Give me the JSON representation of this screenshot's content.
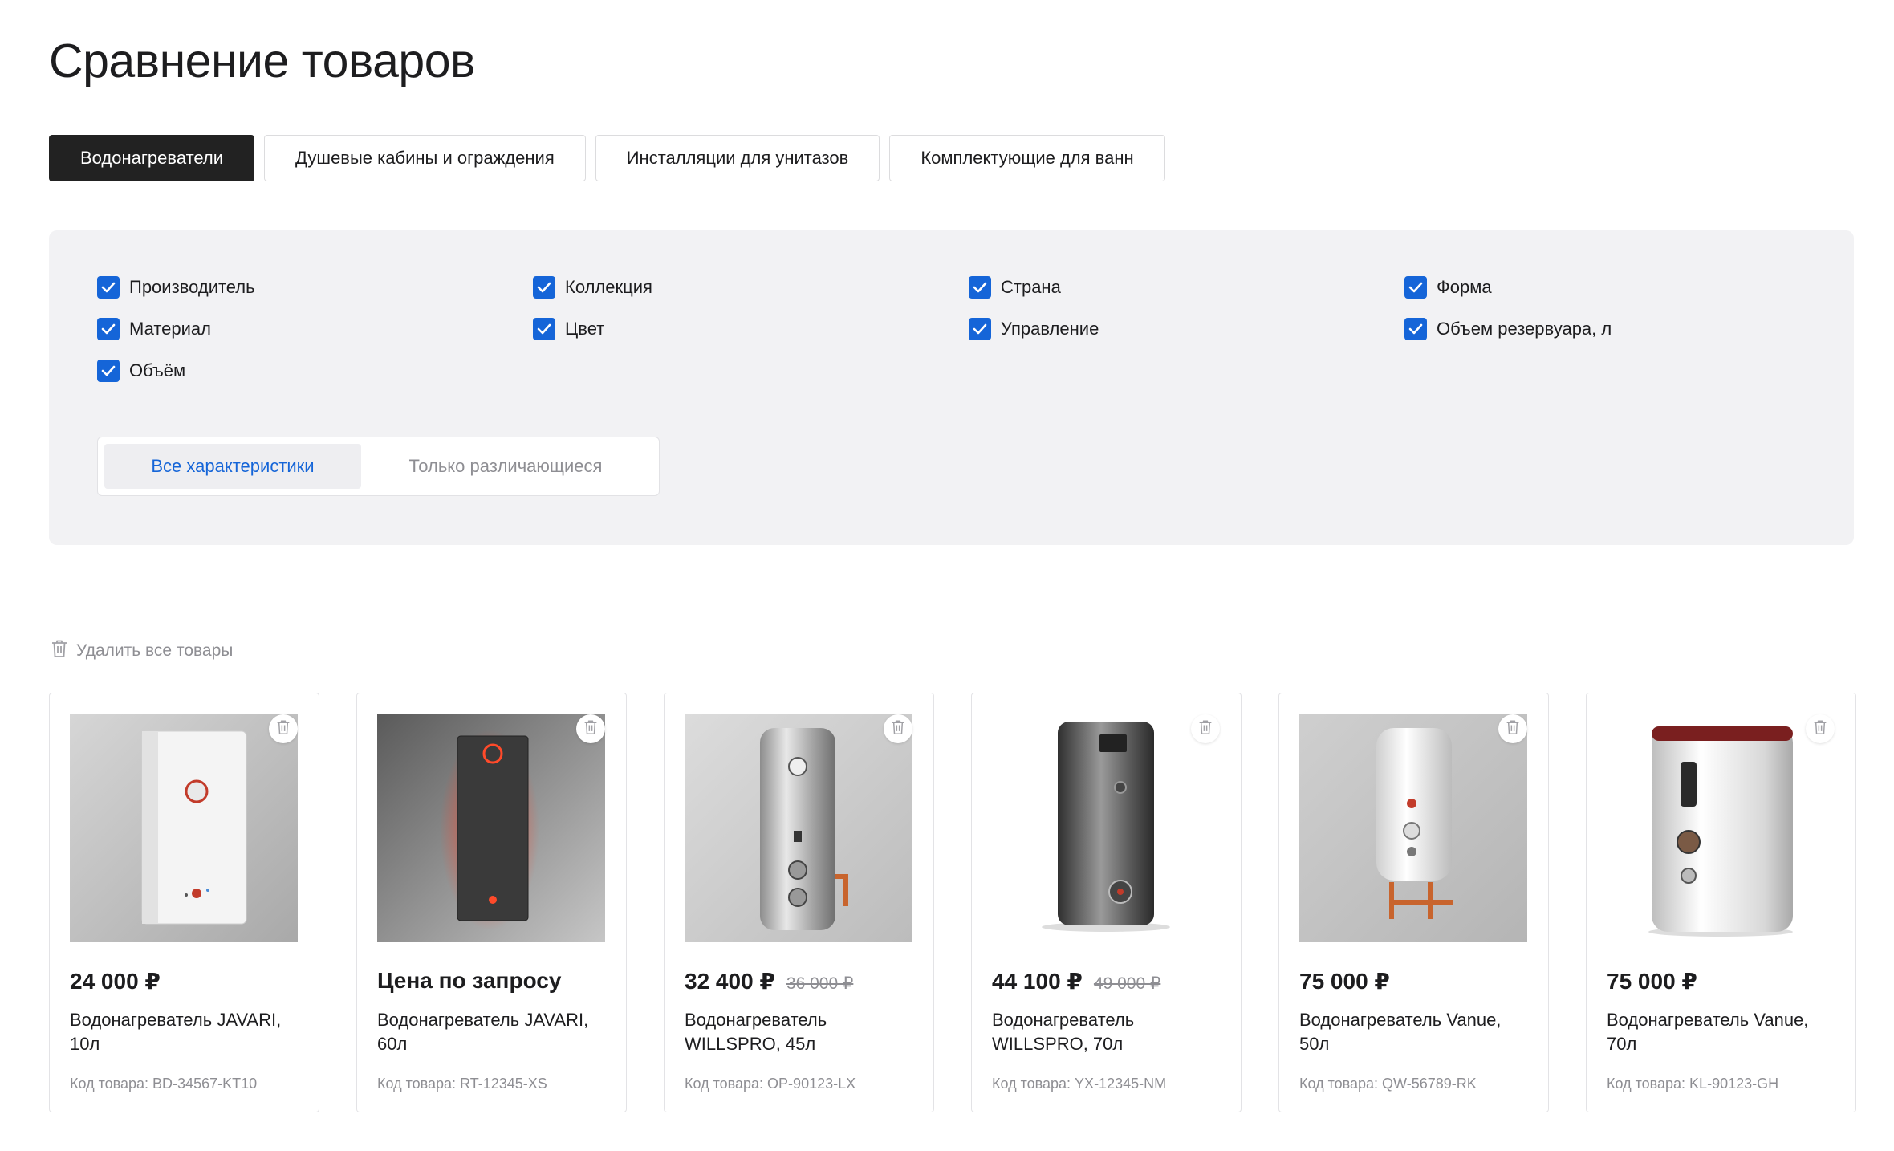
{
  "page": {
    "title": "Сравнение товаров"
  },
  "tabs": [
    {
      "label": "Водонагреватели",
      "active": true
    },
    {
      "label": "Душевые кабины и ограждения",
      "active": false
    },
    {
      "label": "Инсталляции для унитазов",
      "active": false
    },
    {
      "label": "Комплектующие для ванн",
      "active": false
    }
  ],
  "filters": {
    "characteristics": [
      {
        "label": "Производитель",
        "checked": true
      },
      {
        "label": "Коллекция",
        "checked": true
      },
      {
        "label": "Страна",
        "checked": true
      },
      {
        "label": "Форма",
        "checked": true
      },
      {
        "label": "Материал",
        "checked": true
      },
      {
        "label": "Цвет",
        "checked": true
      },
      {
        "label": "Управление",
        "checked": true
      },
      {
        "label": "Объем резервуара, л",
        "checked": true
      },
      {
        "label": "Объём",
        "checked": true
      }
    ],
    "view_modes": {
      "all_label": "Все характеристики",
      "diff_label": "Только различающиеся",
      "selected": "all"
    }
  },
  "actions": {
    "remove_all_label": "Удалить все товары"
  },
  "products": [
    {
      "price": "24 000 ₽",
      "old_price": "",
      "name": "Водонагреватель JAVARI, 10л",
      "code": "Код товара: BD-34567-KT10"
    },
    {
      "price": "Цена по запросу",
      "old_price": "",
      "name": "Водонагреватель JAVARI, 60л",
      "code": "Код товара: RT-12345-XS"
    },
    {
      "price": "32 400 ₽",
      "old_price": "36 000 ₽",
      "name": "Водонагреватель WILLSPRO, 45л",
      "code": "Код товара: OP-90123-LX"
    },
    {
      "price": "44 100 ₽",
      "old_price": "49 000 ₽",
      "name": "Водонагреватель WILLSPRO, 70л",
      "code": "Код товара: YX-12345-NM"
    },
    {
      "price": "75 000 ₽",
      "old_price": "",
      "name": "Водонагреватель Vanue, 50л",
      "code": "Код товара: QW-56789-RK"
    },
    {
      "price": "75 000 ₽",
      "old_price": "",
      "name": "Водонагреватель Vanue, 70л",
      "code": "Код товара: KL-90123-GH"
    }
  ],
  "icons": {
    "checkbox": "check-icon",
    "remove": "trash-icon"
  },
  "colors": {
    "accent": "#1565d8",
    "active_tab_bg": "#222222",
    "panel_bg": "#f2f2f4",
    "muted_text": "#8e8e93"
  }
}
